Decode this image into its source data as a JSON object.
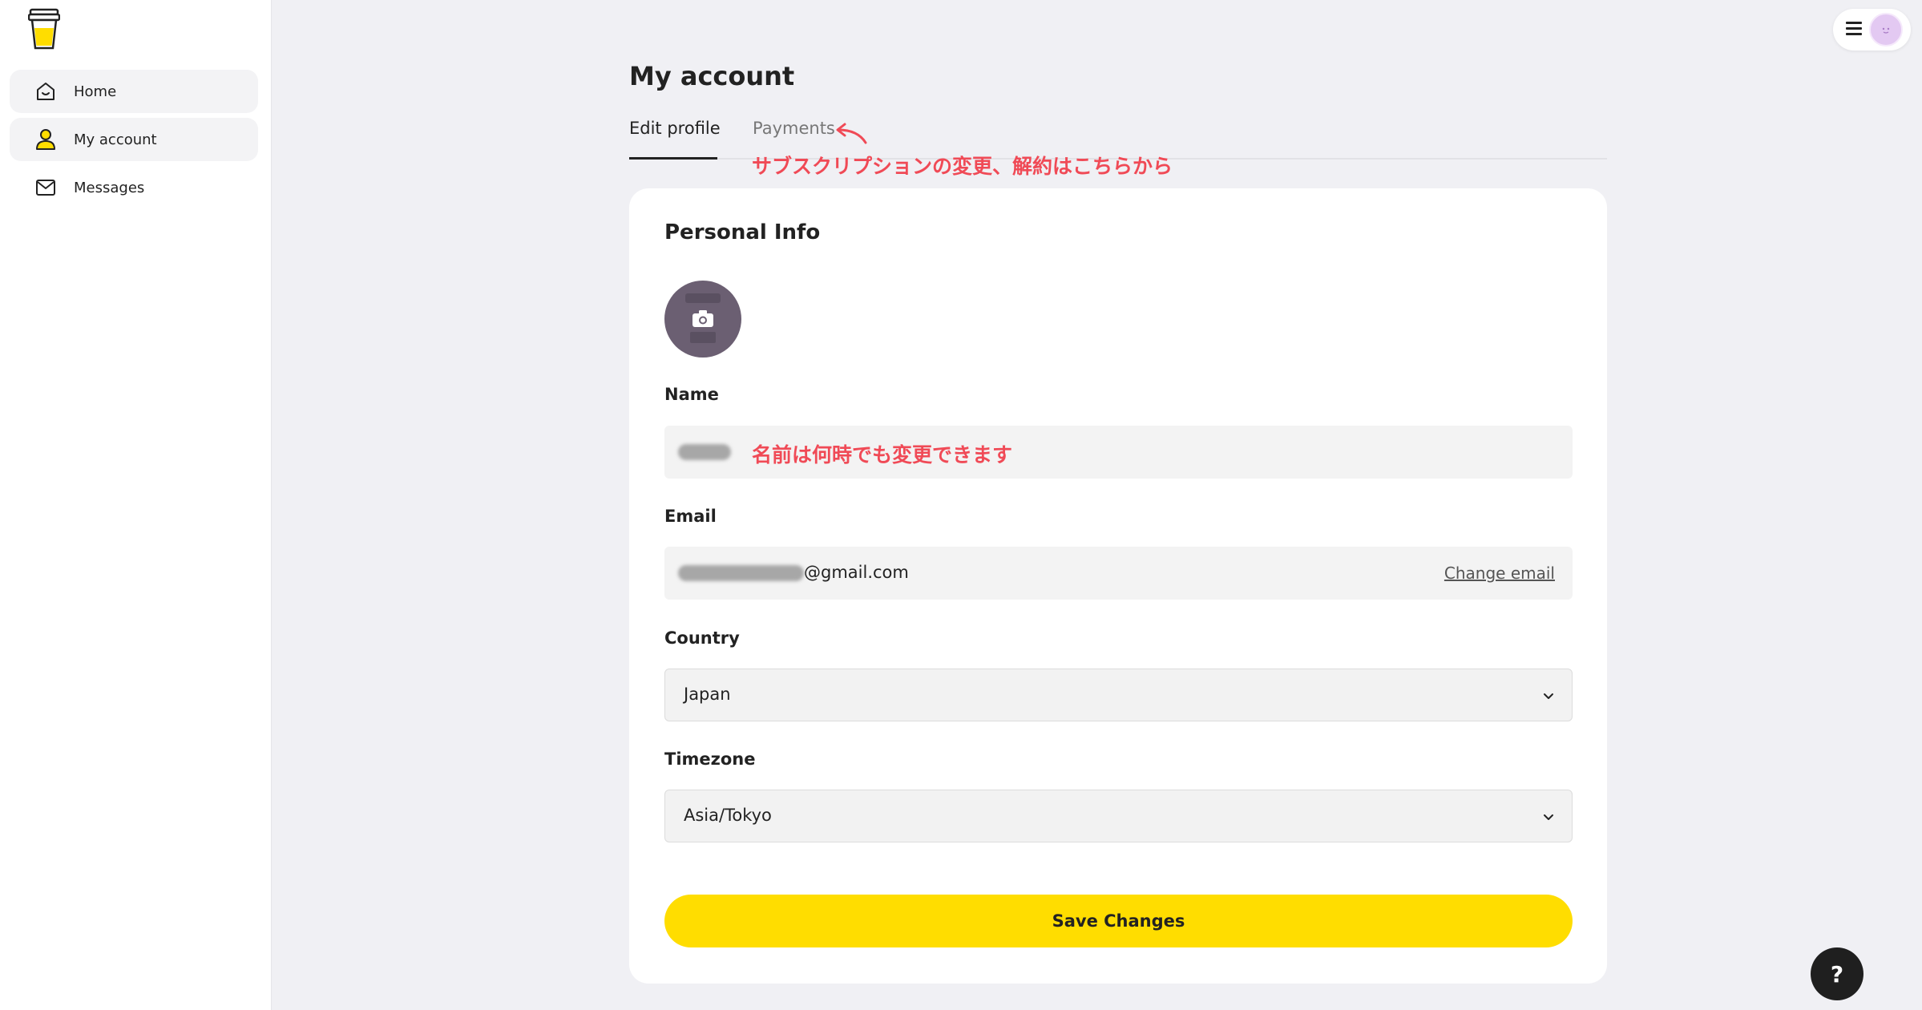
{
  "sidebar": {
    "items": [
      {
        "label": "Home",
        "icon": "home-icon"
      },
      {
        "label": "My account",
        "icon": "user-icon"
      },
      {
        "label": "Messages",
        "icon": "mail-icon"
      }
    ]
  },
  "header": {
    "title": "My account"
  },
  "tabs": [
    {
      "label": "Edit profile",
      "active": true
    },
    {
      "label": "Payments",
      "active": false
    }
  ],
  "annotations": {
    "payments_note": "サブスクリプションの変更、解約はこちらから",
    "name_note": "名前は何時でも変更できます"
  },
  "card": {
    "title": "Personal Info",
    "name_label": "Name",
    "email_label": "Email",
    "email_value_visible": "@gmail.com",
    "change_email": "Change email",
    "country_label": "Country",
    "country_value": "Japan",
    "timezone_label": "Timezone",
    "timezone_value": "Asia/Tokyo",
    "save_label": "Save Changes"
  },
  "help": {
    "label": "?"
  },
  "colors": {
    "accent_yellow": "#ffdd00",
    "annotation_red": "#f04a56",
    "page_background": "#f0f0f4"
  }
}
